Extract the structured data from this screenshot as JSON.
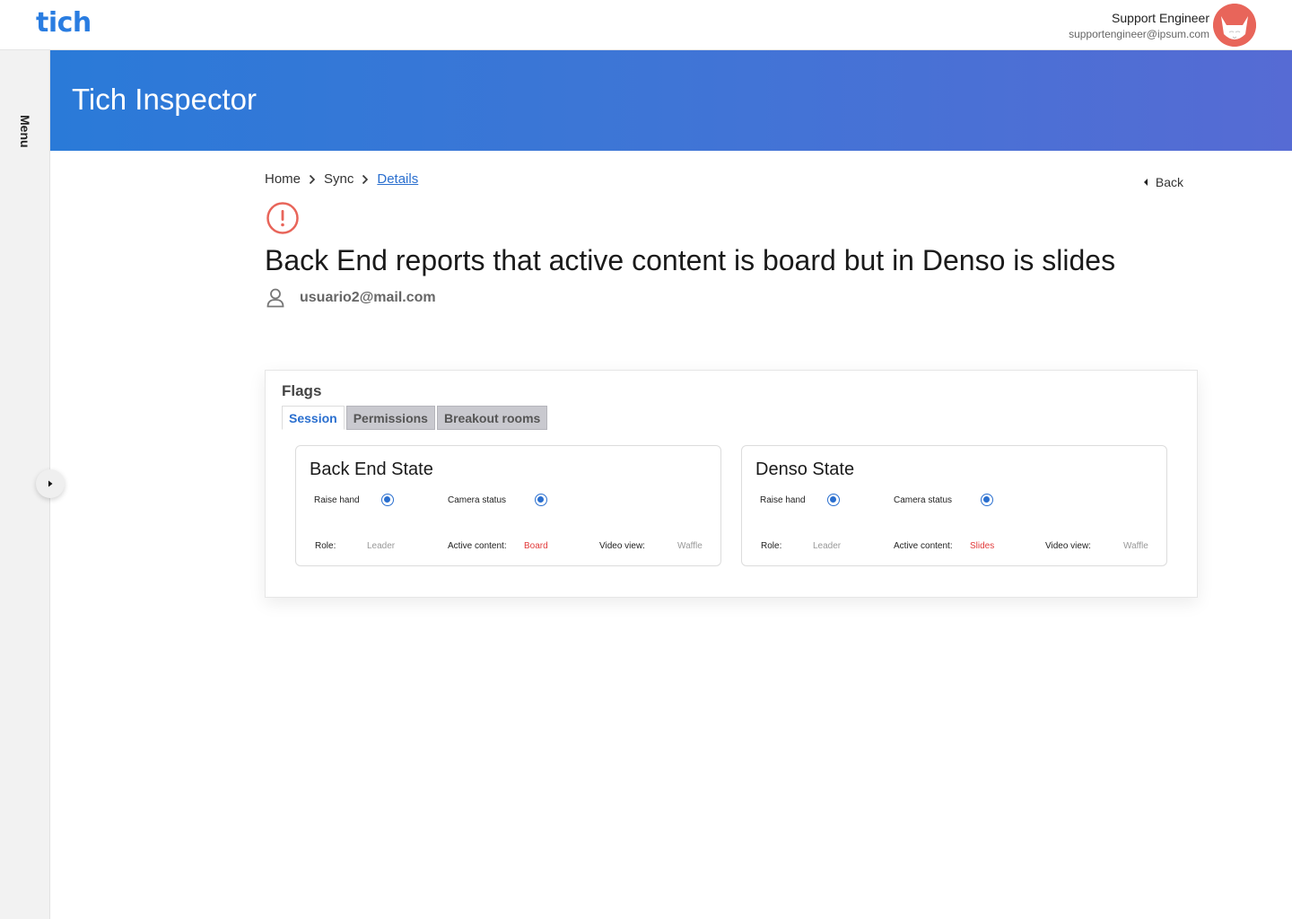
{
  "header": {
    "logo": "tich",
    "user_name": "Support Engineer",
    "user_email": "supportengineer@ipsum.com"
  },
  "sidebar": {
    "menu_label": "Menu"
  },
  "banner": {
    "title": "Tich Inspector"
  },
  "breadcrumb": {
    "items": [
      "Home",
      "Sync",
      "Details"
    ]
  },
  "back_label": "Back",
  "page": {
    "title": "Back End reports that active content is board but in Denso is slides",
    "reporter": "usuario2@mail.com"
  },
  "flags": {
    "title": "Flags",
    "tabs": [
      "Session",
      "Permissions",
      "Breakout rooms"
    ],
    "active_tab": "Session"
  },
  "states": [
    {
      "title": "Back End State",
      "raise_hand_label": "Raise hand",
      "raise_hand": true,
      "camera_label": "Camera status",
      "camera": true,
      "role_label": "Role:",
      "role": "Leader",
      "active_content_label": "Active content:",
      "active_content": "Board",
      "video_view_label": "Video view:",
      "video_view": "Waffle"
    },
    {
      "title": "Denso State",
      "raise_hand_label": "Raise hand",
      "raise_hand": true,
      "camera_label": "Camera status",
      "camera": true,
      "role_label": "Role:",
      "role": "Leader",
      "active_content_label": "Active content:",
      "active_content": "Slides",
      "video_view_label": "Video view:",
      "video_view": "Waffle"
    }
  ],
  "colors": {
    "brand": "#2a7de1",
    "banner_start": "#2a7ad8",
    "banner_end": "#566bd4",
    "alert": "#e8655a",
    "mismatch": "#e23b3b"
  }
}
